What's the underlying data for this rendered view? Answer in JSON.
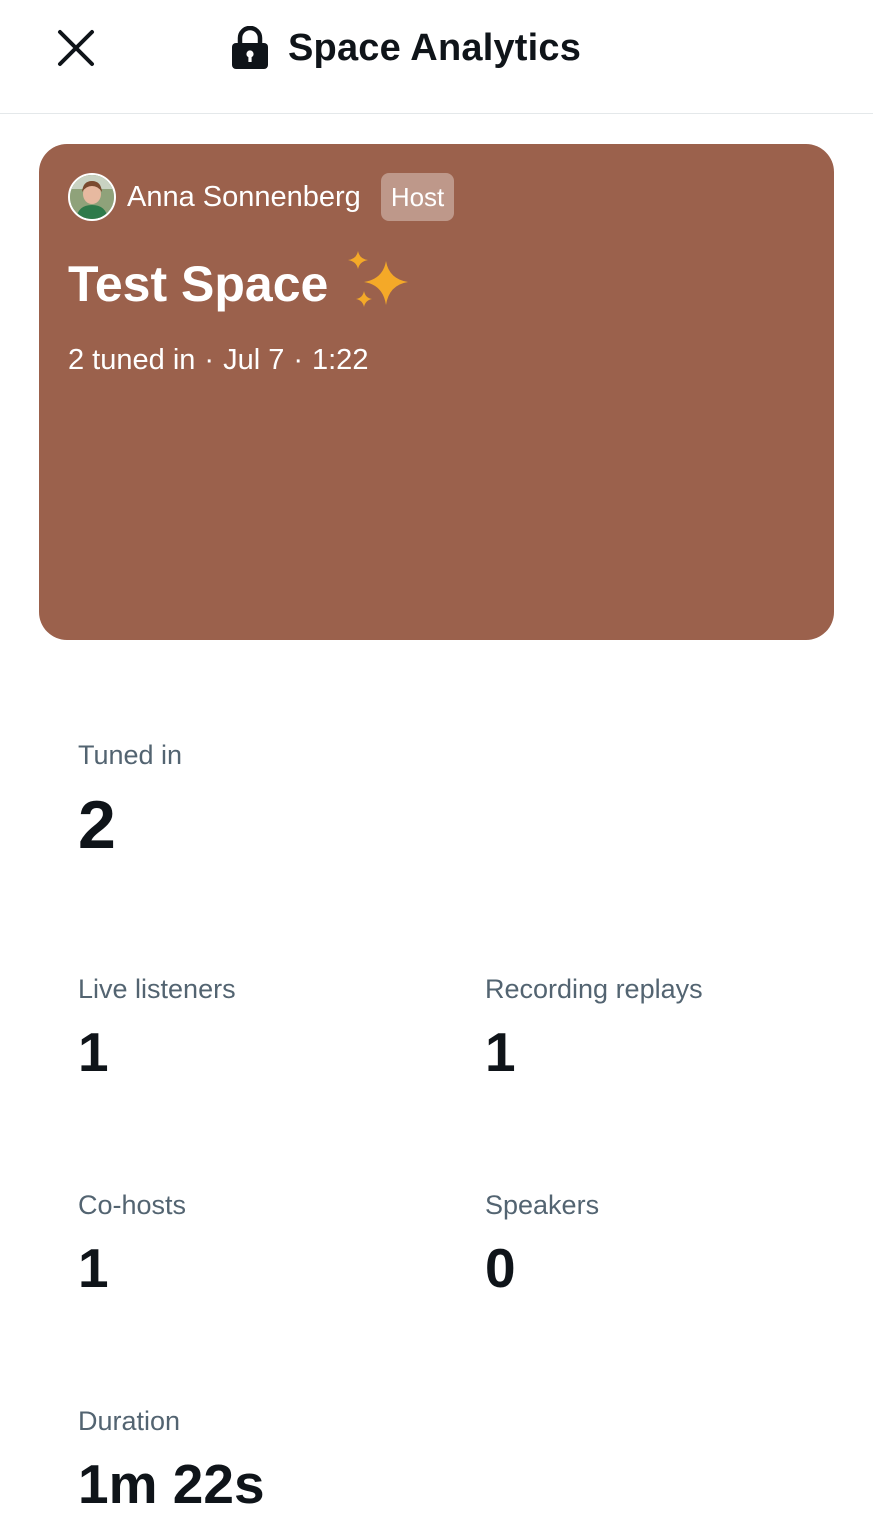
{
  "header": {
    "title": "Space Analytics"
  },
  "icons": {
    "close": "close-icon",
    "lock": "lock-icon",
    "sparkles": "sparkles-icon"
  },
  "colors": {
    "card_background": "#9b614c",
    "label_gray": "#536471",
    "sparkle_yellow": "#f4a928"
  },
  "card": {
    "host_name": "Anna Sonnenberg",
    "host_badge": "Host",
    "space_title": "Test Space",
    "tuned_in": "2 tuned in",
    "separator": "·",
    "date": "Jul 7",
    "time": "1:22"
  },
  "stats": {
    "tuned_in": {
      "label": "Tuned in",
      "value": "2"
    },
    "live_listeners": {
      "label": "Live listeners",
      "value": "1"
    },
    "recording_replays": {
      "label": "Recording replays",
      "value": "1"
    },
    "co_hosts": {
      "label": "Co-hosts",
      "value": "1"
    },
    "speakers": {
      "label": "Speakers",
      "value": "0"
    },
    "duration": {
      "label": "Duration",
      "value": "1m 22s"
    }
  }
}
